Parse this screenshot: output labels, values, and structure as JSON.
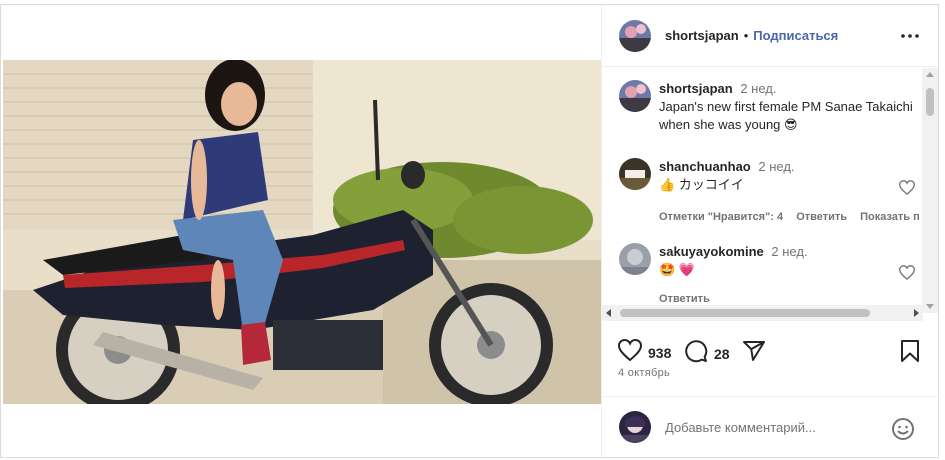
{
  "post": {
    "author": "shortsjapan",
    "separator": "•",
    "follow_label": "Подписаться",
    "more_label": "•••"
  },
  "comments": [
    {
      "username": "shortsjapan",
      "time": "2 нед.",
      "text": "Japan's new first female PM Sanae Takaichi when she was young 😎"
    },
    {
      "username": "shanchuanhao",
      "time": "2 нед.",
      "text": "👍 カッコイイ",
      "likes_label": "Отметки \"Нравится\": 4",
      "reply_label": "Ответить",
      "translate_label": "Показать п"
    },
    {
      "username": "sakuyayokomine",
      "time": "2 нед.",
      "text": "🤩 💗",
      "reply_label": "Ответить"
    }
  ],
  "actions": {
    "likes_count": "938",
    "comments_count": "28"
  },
  "date_label": "4 октябрь",
  "add_comment": {
    "placeholder": "Добавьте комментарий..."
  },
  "icons": {
    "like": "heart-icon",
    "comment": "comment-icon",
    "share": "share-icon",
    "save": "bookmark-icon",
    "emoji": "emoji-icon",
    "more": "more-icon"
  }
}
